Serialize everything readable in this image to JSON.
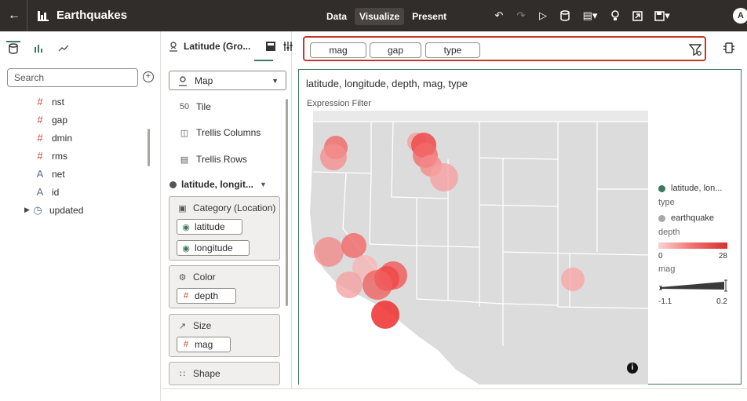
{
  "app": {
    "title": "Earthquakes",
    "avatar": "A"
  },
  "modes": [
    {
      "label": "Data",
      "active": false
    },
    {
      "label": "Visualize",
      "active": true
    },
    {
      "label": "Present",
      "active": false
    }
  ],
  "toolbar_icons": [
    "undo-icon",
    "redo-icon",
    "run-icon",
    "data-source-icon",
    "comment-menu-icon",
    "lightbulb-icon",
    "export-icon",
    "save-icon"
  ],
  "data_panel": {
    "search_placeholder": "Search",
    "fields": [
      {
        "label": "nst",
        "kind": "number"
      },
      {
        "label": "gap",
        "kind": "number"
      },
      {
        "label": "dmin",
        "kind": "number"
      },
      {
        "label": "rms",
        "kind": "number"
      },
      {
        "label": "net",
        "kind": "text"
      },
      {
        "label": "id",
        "kind": "text"
      },
      {
        "label": "updated",
        "kind": "time"
      }
    ]
  },
  "grammar": {
    "viz_name": "Latitude (Gro...",
    "viz_type": "Map",
    "items": [
      "Tile",
      "Trellis Columns",
      "Trellis Rows"
    ],
    "layer": "latitude, longit...",
    "category_label": "Category (Location)",
    "category_pills": [
      "latitude",
      "longitude"
    ],
    "color_label": "Color",
    "color_pill": "depth",
    "size_label": "Size",
    "size_pill": "mag",
    "shape_label": "Shape"
  },
  "filters": [
    "mag",
    "gap",
    "type"
  ],
  "canvas": {
    "title": "latitude, longitude, depth, mag, type",
    "subtitle": "Expression Filter"
  },
  "legend": {
    "layer": "latitude, lon...",
    "type_heading": "type",
    "type_item": "earthquake",
    "depth_heading": "depth",
    "depth_min": "0",
    "depth_max": "28",
    "mag_heading": "mag",
    "mag_min": "-1.1",
    "mag_max": "0.2"
  },
  "colors": {
    "topbar": "#312d2a",
    "accent": "#3c7a5b",
    "filter_border": "#c0392b",
    "marker": "#f25b5b"
  }
}
